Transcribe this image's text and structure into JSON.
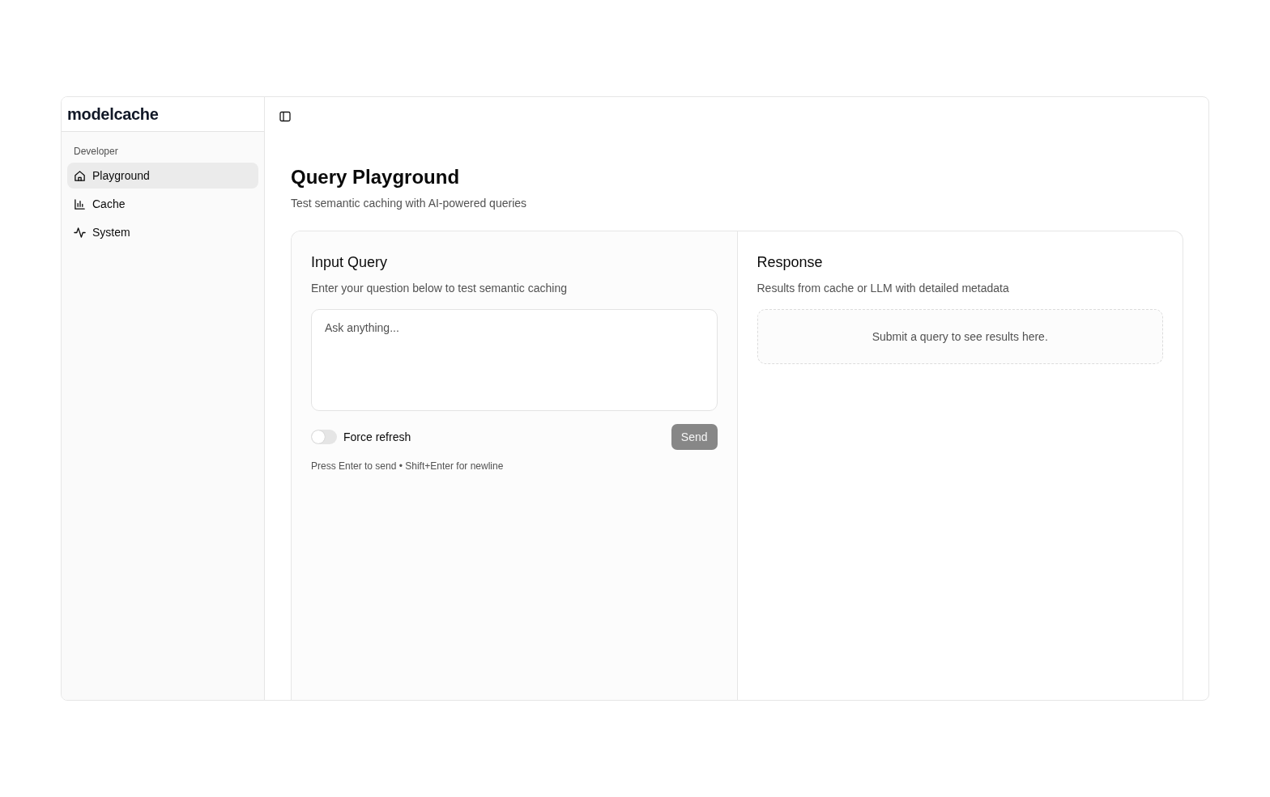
{
  "app": {
    "name": "modelcache"
  },
  "sidebar": {
    "section_label": "Developer",
    "items": [
      {
        "label": "Playground",
        "kind": "home",
        "selected": true
      },
      {
        "label": "Cache",
        "kind": "chart",
        "selected": false
      },
      {
        "label": "System",
        "kind": "activity",
        "selected": false
      }
    ]
  },
  "page": {
    "title": "Query Playground",
    "subtitle": "Test semantic caching with AI-powered queries"
  },
  "input_panel": {
    "title": "Input Query",
    "description": "Enter your question below to test semantic caching",
    "query": {
      "placeholder": "Ask anything..."
    },
    "force_refresh": {
      "label": "Force refresh",
      "on": false
    },
    "send_button": {
      "label": "Send",
      "disabled": true
    },
    "hint": "Press Enter to send • Shift+Enter for newline"
  },
  "response_panel": {
    "title": "Response",
    "description": "Results from cache or LLM with detailed metadata",
    "empty_message": "Submit a query to see results here."
  }
}
